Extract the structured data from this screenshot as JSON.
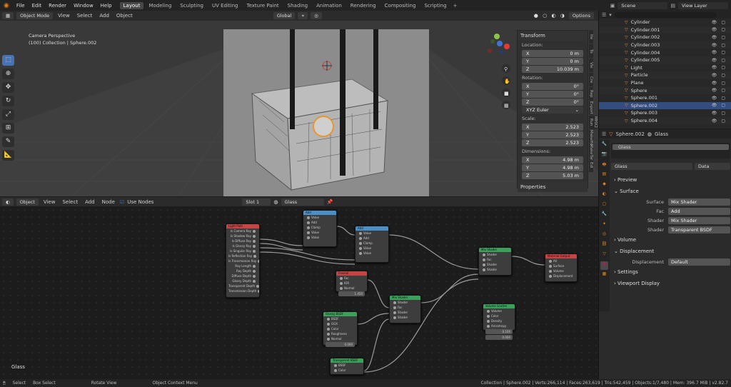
{
  "menu": {
    "file": "File",
    "edit": "Edit",
    "render": "Render",
    "window": "Window",
    "help": "Help"
  },
  "workspaces": [
    "Layout",
    "Modeling",
    "Sculpting",
    "UV Editing",
    "Texture Paint",
    "Shading",
    "Animation",
    "Rendering",
    "Compositing",
    "Scripting"
  ],
  "active_workspace": "Layout",
  "scene": "Scene",
  "view_layer": "View Layer",
  "viewport_header": {
    "mode": "Object Mode",
    "view": "View",
    "select": "Select",
    "add": "Add",
    "object": "Object",
    "orientation": "Global",
    "options": "Options"
  },
  "viewport": {
    "camera": "Camera Perspective",
    "collection": "(100) Collection | Sphere.002"
  },
  "npanel": {
    "transform": "Transform",
    "location": "Location:",
    "rotation": "Rotation:",
    "euler": "XYZ Euler",
    "scale": "Scale:",
    "dimensions": "Dimensions:",
    "properties": "Properties",
    "loc": [
      {
        "axis": "X",
        "v": "0 m"
      },
      {
        "axis": "Y",
        "v": "0 m"
      },
      {
        "axis": "Z",
        "v": "10.039 m"
      }
    ],
    "rot": [
      {
        "axis": "X",
        "v": "0°"
      },
      {
        "axis": "Y",
        "v": "0°"
      },
      {
        "axis": "Z",
        "v": "0°"
      }
    ],
    "scl": [
      {
        "axis": "X",
        "v": "2.523"
      },
      {
        "axis": "Y",
        "v": "2.523"
      },
      {
        "axis": "Z",
        "v": "2.523"
      }
    ],
    "dim": [
      {
        "axis": "X",
        "v": "4.98 m"
      },
      {
        "axis": "Y",
        "v": "4.98 m"
      },
      {
        "axis": "Z",
        "v": "5.03 m"
      }
    ],
    "tabs": [
      "Ite",
      "To",
      "Vie",
      "Cre",
      "Rep",
      "Export",
      "MHX2 Run",
      "MakeHu",
      "MakeTar",
      "Edi"
    ]
  },
  "node_header": {
    "editor": "Object",
    "view": "View",
    "select": "Select",
    "add": "Add",
    "node": "Node",
    "use_nodes": "Use Nodes",
    "slot": "Slot 1",
    "material": "Glass"
  },
  "material_label": "Glass",
  "nodes": {
    "light_path": {
      "title": "Light Path",
      "rows": [
        "Is Camera Ray",
        "Is Shadow Ray",
        "Is Diffuse Ray",
        "Is Glossy Ray",
        "Is Singular Ray",
        "Is Reflection Ray",
        "Is Transmission Ray",
        "Ray Length",
        "Ray Depth",
        "Diffuse Depth",
        "Glossy Depth",
        "Transparent Depth",
        "Transmission Depth"
      ]
    },
    "add1": {
      "title": "Add",
      "rows": [
        "Value",
        "Add",
        "Clamp",
        "Value",
        "Value"
      ]
    },
    "add2": {
      "title": "Add",
      "rows": [
        "Value",
        "Add",
        "Clamp",
        "Value",
        "Value"
      ]
    },
    "fresnel": {
      "title": "Fresnel",
      "rows": [
        "Fac",
        "IOR",
        "Normal"
      ],
      "ior": "1.450"
    },
    "mix1": {
      "title": "Mix Shader",
      "rows": [
        "Shader",
        "Fac",
        "Shader",
        "Shader"
      ]
    },
    "mix2": {
      "title": "Mix Shader",
      "rows": [
        "Shader",
        "Fac",
        "Shader",
        "Shader"
      ]
    },
    "glossy": {
      "title": "Glossy BSDF",
      "rows": [
        "BSDF",
        "GGX",
        "Color",
        "Roughness",
        "Normal"
      ],
      "roughness": "0.000"
    },
    "transparent": {
      "title": "Transparent BSDF",
      "rows": [
        "BSDF",
        "Color"
      ]
    },
    "volume": {
      "title": "Volume Scatter",
      "rows": [
        "Volume",
        "Color",
        "Density",
        "Anisotropy"
      ],
      "density": "0.100",
      "anisotropy": "0.000"
    },
    "output": {
      "title": "Material Output",
      "rows": [
        "All",
        "Surface",
        "Volume",
        "Displacement"
      ]
    }
  },
  "outliner": [
    {
      "name": "Cylinder"
    },
    {
      "name": "Cylinder.001"
    },
    {
      "name": "Cylinder.002"
    },
    {
      "name": "Cylinder.003"
    },
    {
      "name": "Cylinder.004"
    },
    {
      "name": "Cylinder.005"
    },
    {
      "name": "Light"
    },
    {
      "name": "Particle"
    },
    {
      "name": "Plane"
    },
    {
      "name": "Sphere"
    },
    {
      "name": "Sphere.001"
    },
    {
      "name": "Sphere.002"
    },
    {
      "name": "Sphere.003"
    },
    {
      "name": "Sphere.004"
    }
  ],
  "outliner_selected": "Sphere.002",
  "props": {
    "object": "Sphere.002",
    "material": "Glass",
    "slot": "Glass",
    "data": "Data",
    "preview": "Preview",
    "surface_sec": "Surface",
    "volume_sec": "Volume",
    "displacement_sec": "Displacement",
    "settings_sec": "Settings",
    "viewport_display_sec": "Viewport Display",
    "rows": [
      {
        "label": "Surface",
        "value": "Mix Shader"
      },
      {
        "label": "Fac",
        "value": "Add"
      },
      {
        "label": "Shader",
        "value": "Mix Shader"
      },
      {
        "label": "Shader",
        "value": "Transparent BSDF"
      }
    ],
    "displacement": {
      "label": "Displacement",
      "value": "Default"
    }
  },
  "status": {
    "select": "Select",
    "box": "Box Select",
    "rotate": "Rotate View",
    "context": "Object Context Menu",
    "stats": "Collection | Sphere.002 | Verts:266,114 | Faces:263,619 | Tris:542,459 | Objects:1/7,480 | Mem: 396.7 MiB | v2.82.7"
  }
}
